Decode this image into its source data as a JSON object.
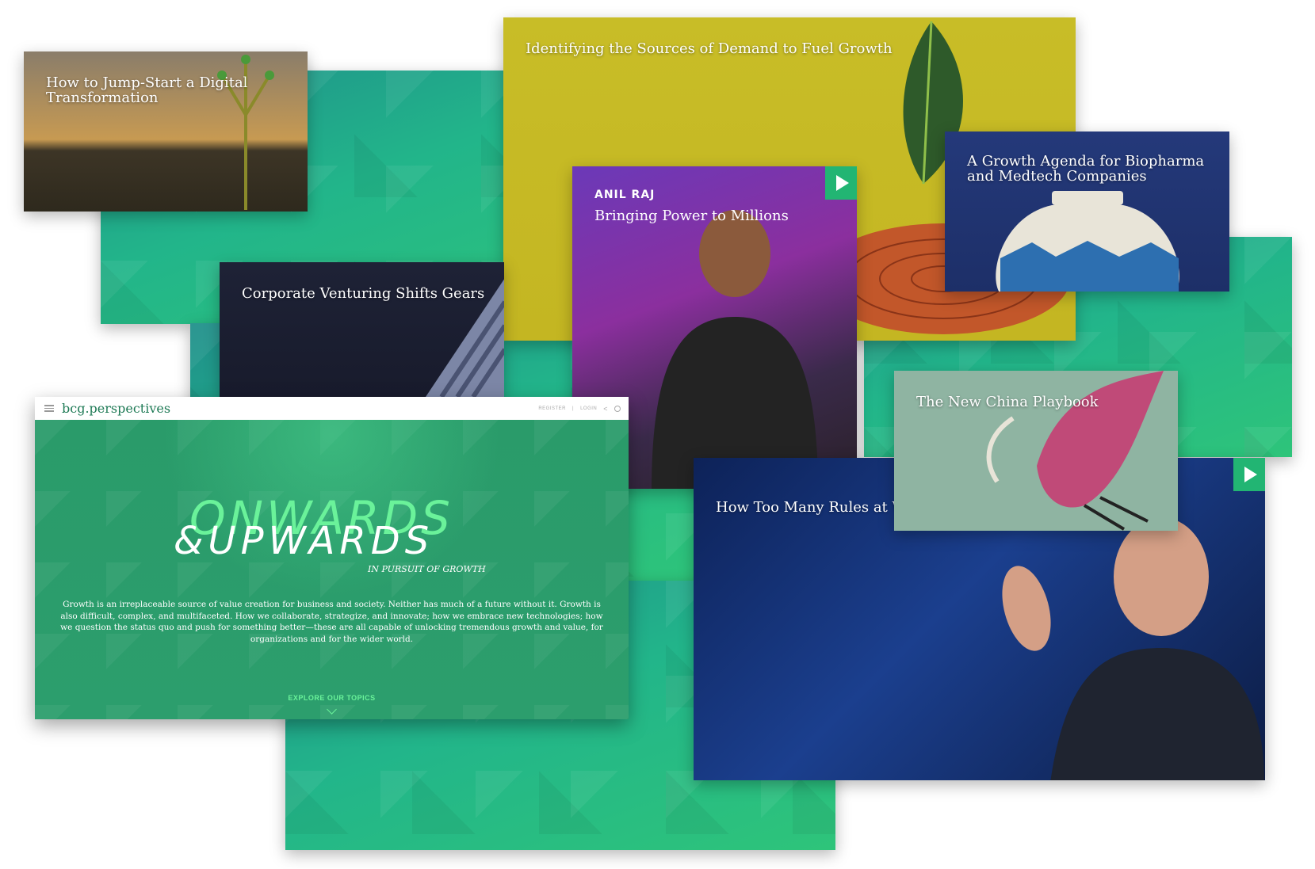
{
  "cards": {
    "jumpstart": {
      "title": "How to Jump-Start a Digital\nTransformation"
    },
    "demand": {
      "title": "Identifying the Sources of Demand to Fuel Growth"
    },
    "biopharma": {
      "title": "A Growth Agenda for Biopharma\nand Medtech Companies"
    },
    "venturing": {
      "title": "Corporate Venturing Shifts Gears"
    },
    "anil": {
      "speaker": "ANIL RAJ",
      "title": "Bringing Power to Millions"
    },
    "china": {
      "title": "The New China Playbook"
    },
    "rules": {
      "title": "How Too Many Rules at W"
    }
  },
  "hero": {
    "brand": "bcg.perspectives",
    "register": "REGISTER",
    "login": "LOGIN",
    "logo_line1": "ONWARDS",
    "logo_line2": "&UPWARDS",
    "logo_sub": "IN PURSUIT OF GROWTH",
    "description": "Growth is an irreplaceable source of value creation for business and society. Neither has much of a future without it. Growth is also difficult, complex, and multifaceted. How we collaborate, strategize, and innovate; how we embrace new technologies; how we question the status quo and push for something better—these are all capable of unlocking tremendous growth and value, for organizations and for the wider world.",
    "explore": "EXPLORE OUR TOPICS"
  },
  "icons": [
    "menu-icon",
    "share-icon",
    "search-icon",
    "play-icon",
    "chevron-down-icon"
  ]
}
